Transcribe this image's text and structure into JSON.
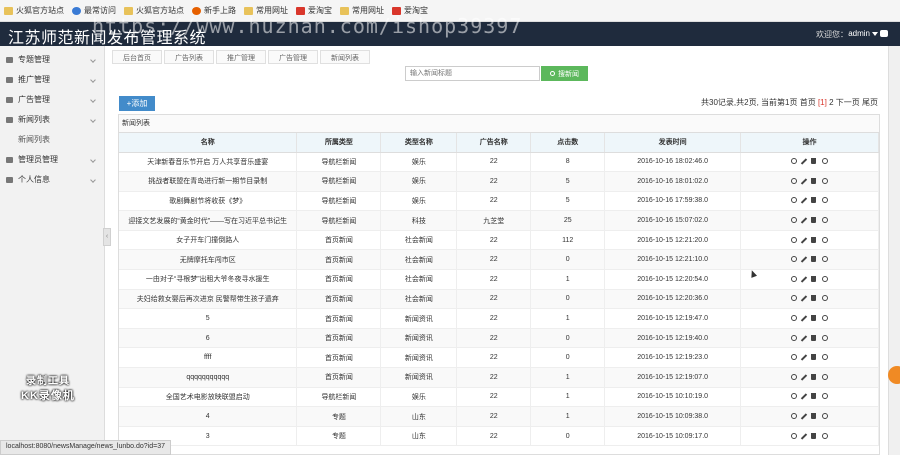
{
  "bookmarks": [
    {
      "label": "火狐官方站点",
      "icon": "folder-icon"
    },
    {
      "label": "最常访问",
      "icon": "globe-icon"
    },
    {
      "label": "火狐官方站点",
      "icon": "folder-icon"
    },
    {
      "label": "新手上路",
      "icon": "firefox-icon"
    },
    {
      "label": "常用网址",
      "icon": "folder-icon"
    },
    {
      "label": "爱淘宝",
      "icon": "taobao-icon"
    },
    {
      "label": "常用网址",
      "icon": "folder-icon"
    },
    {
      "label": "爱淘宝",
      "icon": "taobao-icon"
    }
  ],
  "header": {
    "title": "江苏师范新闻发布管理系统",
    "watermark": "https://www.huzhan.com/ishop39397",
    "welcome": "欢迎您：",
    "user": "admin"
  },
  "sidebar": {
    "items": [
      {
        "label": "专题管理"
      },
      {
        "label": "推广管理"
      },
      {
        "label": "广告管理"
      },
      {
        "label": "新闻列表"
      }
    ],
    "sub_item": "新闻列表",
    "items_after": [
      {
        "label": "管理员管理"
      },
      {
        "label": "个人信息"
      }
    ],
    "recorder_line1": "录制工具",
    "recorder_line2": "KK录像机"
  },
  "breadcrumb": [
    "后台首页",
    "广告列表",
    "推广管理",
    "广告管理",
    "新闻列表"
  ],
  "search": {
    "placeholder": "输入新闻标题",
    "button": "搜新闻"
  },
  "add_button": "+添加",
  "pager": {
    "prefix": "共30记录,共2页, 当前第1页 首页",
    "current": "[1]",
    "suffix": "2 下一页 尾页"
  },
  "panel_title": "新闻列表",
  "table": {
    "headers": [
      "名称",
      "所属类型",
      "类型名称",
      "广告名称",
      "点击数",
      "发表时间",
      "操作"
    ],
    "rows": [
      [
        "天津新春音乐节开启 万人共享音乐盛宴",
        "导航栏新闻",
        "娱乐",
        "22",
        "8",
        "2016-10-16 18:02:46.0"
      ],
      [
        "挑战者联盟在青岛进行新一期节目录制",
        "导航栏新闻",
        "娱乐",
        "22",
        "5",
        "2016-10-16 18:01:02.0"
      ],
      [
        "歌剧舞剧节将收获《梦》",
        "导航栏新闻",
        "娱乐",
        "22",
        "5",
        "2016-10-16 17:59:38.0"
      ],
      [
        "迎接文艺发展的“黄金时代”——写在习近平总书记生",
        "导航栏新闻",
        "科技",
        "九芝堂",
        "25",
        "2016-10-16 15:07:02.0"
      ],
      [
        "女子开车门撞倒路人",
        "首页新闻",
        "社会新闻",
        "22",
        "112",
        "2016-10-15 12:21:20.0"
      ],
      [
        "无牌摩托车闯市区",
        "首页新闻",
        "社会新闻",
        "22",
        "0",
        "2016-10-15 12:21:10.0"
      ],
      [
        "一由对子“寻根梦”出租大爷冬夜寻水援生",
        "首页新闻",
        "社会新闻",
        "22",
        "1",
        "2016-10-15 12:20:54.0"
      ],
      [
        "夫妇给救女婴后再次进京 民警帮带生孩子遗弃",
        "首页新闻",
        "社会新闻",
        "22",
        "0",
        "2016-10-15 12:20:36.0"
      ],
      [
        "5",
        "首页新闻",
        "新闻资讯",
        "22",
        "1",
        "2016-10-15 12:19:47.0"
      ],
      [
        "6",
        "首页新闻",
        "新闻资讯",
        "22",
        "0",
        "2016-10-15 12:19:40.0"
      ],
      [
        "ffff",
        "首页新闻",
        "新闻资讯",
        "22",
        "0",
        "2016-10-15 12:19:23.0"
      ],
      [
        "qqqqqqqqqqq",
        "首页新闻",
        "新闻资讯",
        "22",
        "1",
        "2016-10-15 12:19:07.0"
      ],
      [
        "全国艺术电影放映联盟启动",
        "导航栏新闻",
        "娱乐",
        "22",
        "1",
        "2016-10-15 10:10:19.0"
      ],
      [
        "4",
        "专题",
        "山东",
        "22",
        "1",
        "2016-10-15 10:09:38.0"
      ],
      [
        "3",
        "专题",
        "山东",
        "22",
        "0",
        "2016-10-15 10:09:17.0"
      ]
    ]
  },
  "status_url": "localhost:8080/newsManage/news_lunbo.do?id=37"
}
